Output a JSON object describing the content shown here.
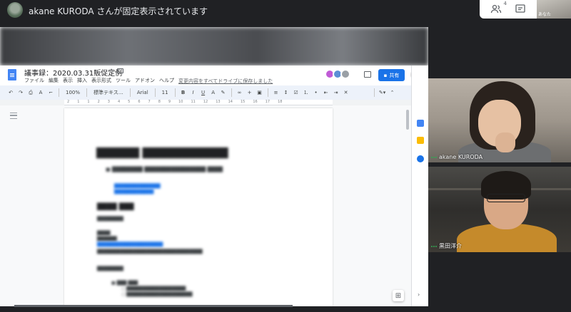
{
  "meet": {
    "pin_text": "akane KURODA さんが固定表示されています",
    "people_count": "4",
    "self_label": "あなた"
  },
  "doc": {
    "title": "議事録：2020.03.31販促定例",
    "menu": [
      "ファイル",
      "編集",
      "表示",
      "挿入",
      "表示形式",
      "ツール",
      "アドオン",
      "ヘルプ"
    ],
    "save_note": "変更内容をすべてドライブに保存しました",
    "share_label": "共有",
    "toolbar": {
      "zoom": "100%",
      "style": "標準テキス…",
      "font": "Arial",
      "size": "11"
    },
    "ruler": [
      "2",
      "1",
      "1",
      "2",
      "3",
      "4",
      "5",
      "6",
      "7",
      "8",
      "9",
      "10",
      "11",
      "12",
      "13",
      "14",
      "15",
      "16",
      "17",
      "18"
    ]
  },
  "participants": [
    {
      "name": "akane KURODA"
    },
    {
      "name": "黒田洋介"
    }
  ],
  "colors": {
    "share_button": "#1a73e8",
    "docs_blue": "#4285f4",
    "active_audio": "#34a853"
  }
}
